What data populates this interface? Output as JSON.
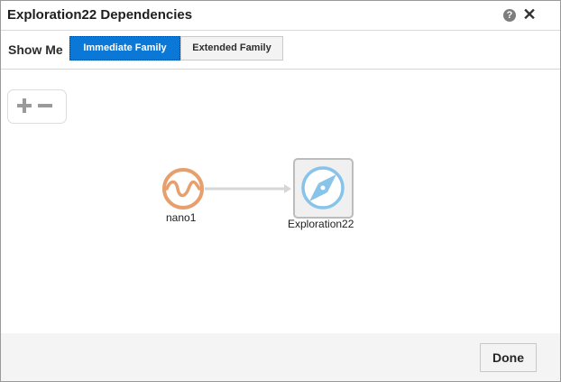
{
  "dialog": {
    "title": "Exploration22 Dependencies",
    "help_icon": "question-circle-icon",
    "close_icon": "close-icon",
    "close_glyph": "✕",
    "help_glyph": "?"
  },
  "toolbar": {
    "show_me_label": "Show Me",
    "segments": [
      {
        "label": "Immediate Family",
        "selected": true
      },
      {
        "label": "Extended Family",
        "selected": false
      }
    ]
  },
  "zoom": {
    "zoom_in_icon": "plus-icon",
    "zoom_out_icon": "minus-icon"
  },
  "graph": {
    "nodes": [
      {
        "label": "nano1",
        "icon": "waveform-icon",
        "accent_color": "#e7a06d"
      },
      {
        "label": "Exploration22",
        "icon": "compass-icon",
        "accent_color": "#88c3ea",
        "selected": true
      }
    ],
    "edge": {
      "from": "nano1",
      "to": "Exploration22",
      "color": "#d6d6d6"
    }
  },
  "footer": {
    "done_label": "Done"
  }
}
